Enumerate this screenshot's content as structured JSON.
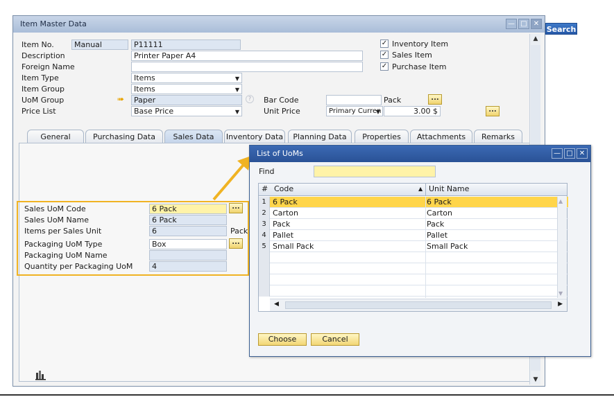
{
  "window": {
    "title": "Item Master Data"
  },
  "search_button": "Search",
  "header": {
    "item_no_label": "Item No.",
    "item_no_series": "Manual",
    "item_no_value": "P11111",
    "description_label": "Description",
    "description_value": "Printer Paper A4",
    "foreign_name_label": "Foreign Name",
    "foreign_name_value": "",
    "item_type_label": "Item Type",
    "item_type_value": "Items",
    "item_group_label": "Item Group",
    "item_group_value": "Items",
    "uom_group_label": "UoM Group",
    "uom_group_value": "Paper",
    "price_list_label": "Price List",
    "price_list_value": "Base Price",
    "bar_code_label": "Bar Code",
    "bar_code_value": "",
    "bar_code_unit": "Pack",
    "unit_price_label": "Unit Price",
    "unit_price_currency": "Primary Curren",
    "unit_price_value": "3.00 $",
    "inventory_item_label": "Inventory Item",
    "sales_item_label": "Sales Item",
    "purchase_item_label": "Purchase Item",
    "inventory_item_checked": true,
    "sales_item_checked": true,
    "purchase_item_checked": true
  },
  "tabs": [
    {
      "label": "General",
      "active": false
    },
    {
      "label": "Purchasing Data",
      "active": false
    },
    {
      "label": "Sales Data",
      "active": true
    },
    {
      "label": "Inventory Data",
      "active": false
    },
    {
      "label": "Planning Data",
      "active": false
    },
    {
      "label": "Properties",
      "active": false
    },
    {
      "label": "Attachments",
      "active": false
    },
    {
      "label": "Remarks",
      "active": false
    }
  ],
  "sales": {
    "sales_uom_code_label": "Sales UoM Code",
    "sales_uom_code_value": "6 Pack",
    "sales_uom_name_label": "Sales UoM Name",
    "sales_uom_name_value": "6 Pack",
    "items_per_sales_unit_label": "Items per Sales Unit",
    "items_per_sales_unit_value": "6",
    "items_per_sales_unit_unit": "Pack",
    "packaging_uom_type_label": "Packaging UoM Type",
    "packaging_uom_type_value": "Box",
    "packaging_uom_name_label": "Packaging UoM Name",
    "packaging_uom_name_value": "",
    "quantity_per_packaging_label": "Quantity per Packaging UoM",
    "quantity_per_packaging_value": "4"
  },
  "dialog": {
    "title": "List of UoMs",
    "find_label": "Find",
    "find_value": "",
    "col_num": "#",
    "col_code": "Code",
    "col_name": "Unit Name",
    "rows": [
      {
        "num": "1",
        "code": "6 Pack",
        "name": "6 Pack"
      },
      {
        "num": "2",
        "code": "Carton",
        "name": "Carton"
      },
      {
        "num": "3",
        "code": "Pack",
        "name": "Pack"
      },
      {
        "num": "4",
        "code": "Pallet",
        "name": "Pallet"
      },
      {
        "num": "5",
        "code": "Small Pack",
        "name": "Small Pack"
      }
    ],
    "choose_label": "Choose",
    "cancel_label": "Cancel"
  },
  "colors": {
    "highlight": "#f0b323",
    "selected_row": "#ffd54a",
    "dialog_title": "#2a5296"
  }
}
